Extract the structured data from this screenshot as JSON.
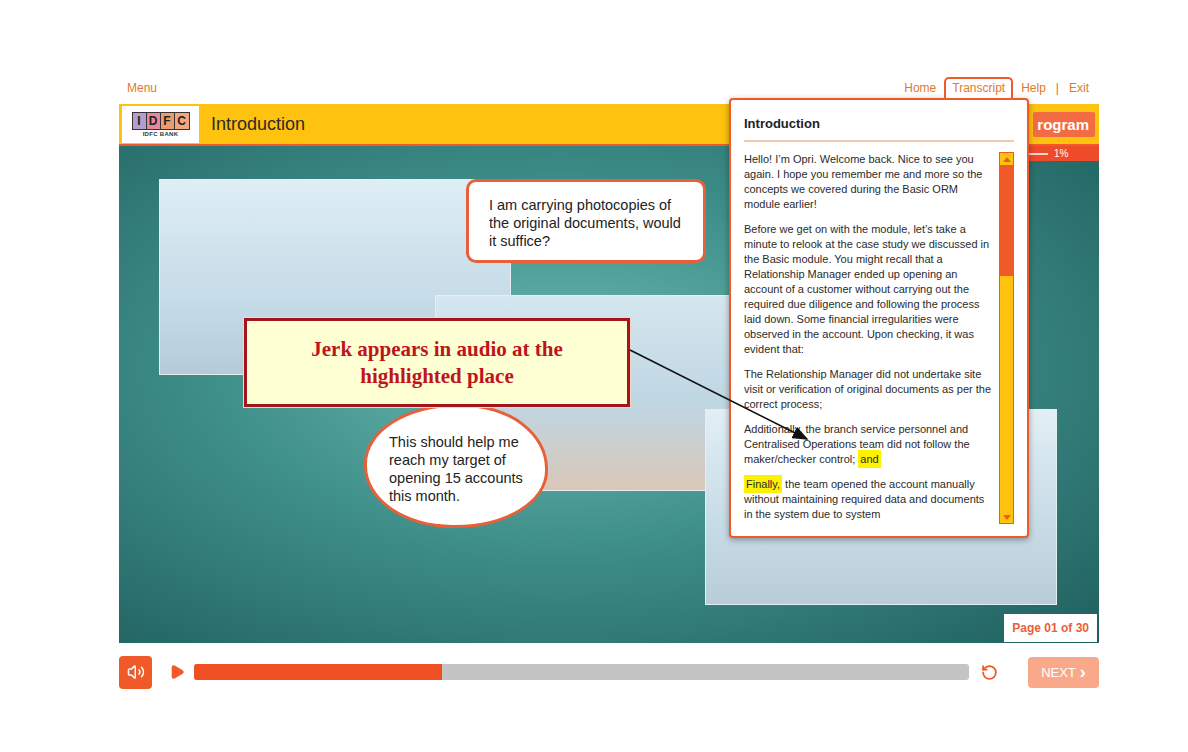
{
  "top_links": {
    "left": "Menu",
    "right": [
      {
        "label": "Home",
        "kind": "link",
        "selected": false
      },
      {
        "label": "Transcript",
        "kind": "tab",
        "selected": true
      },
      {
        "label": "Help",
        "kind": "link",
        "selected": false
      },
      {
        "label": "|",
        "kind": "separator",
        "selected": false
      },
      {
        "label": "Exit",
        "kind": "link",
        "selected": false
      }
    ]
  },
  "header": {
    "logo": {
      "letters": [
        {
          "char": "I",
          "color": "#b49ed0"
        },
        {
          "char": "D",
          "color": "#e8879c"
        },
        {
          "char": "F",
          "color": "#f09a6a"
        },
        {
          "char": "C",
          "color": "#f5a47c"
        }
      ],
      "caption": "IDFC BANK"
    },
    "title": "Introduction",
    "program_label": "rogram",
    "progress_reading": "1%",
    "progress_level": 0.01
  },
  "bubbles": [
    {
      "kind": "speech",
      "text": "I am carrying photocopies of the original documents, would it suffice?"
    },
    {
      "kind": "thought",
      "text": "This should help me reach my target of opening 15 accounts this month."
    }
  ],
  "transcript": {
    "title": "Introduction",
    "scroll_level": 0.32,
    "paragraphs": [
      [
        {
          "text": "Hello! I’m Opri. Welcome back. Nice to see you again. I hope you remember me and more so the concepts we covered during the Basic ORM module earlier!",
          "highlighted": false
        }
      ],
      [
        {
          "text": "Before we get on with the module, let’s take a minute to relook at the case study we discussed in the Basic module. You might recall that a Relationship Manager ended up opening an account of a customer without carrying out the required due diligence and following the process laid down. Some financial irregularities were observed in the account. Upon checking, it was evident that:",
          "highlighted": false
        }
      ],
      [
        {
          "text": "The Relationship Manager did not undertake site visit or verification of original documents as per the correct process;",
          "highlighted": false
        }
      ],
      [
        {
          "text": "Additionally, the branch service personnel and Centralised Operations team did not follow the maker/checker control; ",
          "highlighted": false
        },
        {
          "text": "and",
          "highlighted": true
        }
      ],
      [
        {
          "text": "Finally,",
          "highlighted": true
        },
        {
          "text": " the team opened the account manually without maintaining required data and documents in the system due to system",
          "highlighted": false
        }
      ]
    ]
  },
  "annotation": {
    "text": "Jerk appears in audio at the highlighted place"
  },
  "page_indicator": "Page 01 of 30",
  "player": {
    "muted": false,
    "playing": false,
    "level": 0.32,
    "next": {
      "label": "NEXT",
      "arrow": "›",
      "disabled": true
    }
  }
}
